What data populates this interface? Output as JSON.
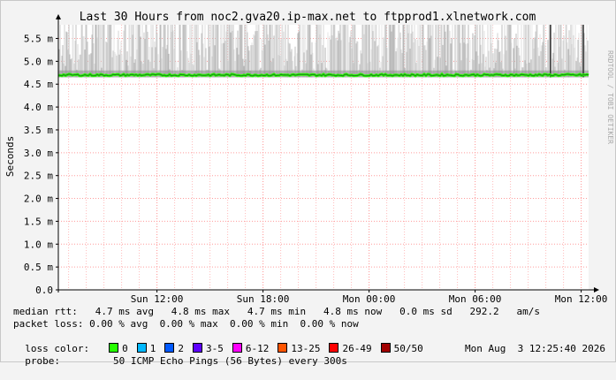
{
  "side_label": "RRDTOOL / TOBI OETIKER",
  "chart_data": {
    "type": "line",
    "title": "Last 30 Hours from noc2.gva20.ip-max.net to ftpprod1.xlnetwork.com",
    "ylabel": "Seconds",
    "xlabel": "",
    "ylim": [
      0,
      0.0058
    ],
    "yticks": [
      {
        "v": 0.0,
        "label": "0.0"
      },
      {
        "v": 0.0005,
        "label": "0.5 m"
      },
      {
        "v": 0.001,
        "label": "1.0 m"
      },
      {
        "v": 0.0015,
        "label": "1.5 m"
      },
      {
        "v": 0.002,
        "label": "2.0 m"
      },
      {
        "v": 0.0025,
        "label": "2.5 m"
      },
      {
        "v": 0.003,
        "label": "3.0 m"
      },
      {
        "v": 0.0035,
        "label": "3.5 m"
      },
      {
        "v": 0.004,
        "label": "4.0 m"
      },
      {
        "v": 0.0045,
        "label": "4.5 m"
      },
      {
        "v": 0.005,
        "label": "5.0 m"
      },
      {
        "v": 0.0055,
        "label": "5.5 m"
      }
    ],
    "xlim_hours": [
      0,
      30
    ],
    "xticks": [
      {
        "h": 5.58,
        "label": "Sun 12:00"
      },
      {
        "h": 11.58,
        "label": "Sun 18:00"
      },
      {
        "h": 17.58,
        "label": "Mon 00:00"
      },
      {
        "h": 23.58,
        "label": "Mon 06:00"
      },
      {
        "h": 29.58,
        "label": "Mon 12:00"
      }
    ],
    "median_rtt_s": 0.0047,
    "smoke_low_s": 0.00465,
    "smoke_high_s": 0.0058,
    "series": [
      {
        "name": "median rtt",
        "color": "#1f7a1f",
        "avg": 0.0047
      }
    ]
  },
  "stats": {
    "median_rtt": "median rtt:   4.7 ms avg   4.8 ms max   4.7 ms min   4.8 ms now   0.0 ms sd   292.2   am/s",
    "packet_loss": "packet loss: 0.00 % avg  0.00 % max  0.00 % min  0.00 % now",
    "loss_color_label": "loss color:",
    "loss_colors": [
      {
        "label": "0",
        "color": "#26ff00"
      },
      {
        "label": "1",
        "color": "#00b8ff"
      },
      {
        "label": "2",
        "color": "#0059ff"
      },
      {
        "label": "3-5",
        "color": "#5e00ff"
      },
      {
        "label": "6-12",
        "color": "#ff00ff"
      },
      {
        "label": "13-25",
        "color": "#ff5500"
      },
      {
        "label": "26-49",
        "color": "#ff0000"
      },
      {
        "label": "50/50",
        "color": "#a10000"
      }
    ],
    "probe_label": "probe:",
    "probe_text": "50 ICMP Echo Pings (56 Bytes) every 300s",
    "timestamp": "Mon Aug  3 12:25:40 2026"
  }
}
